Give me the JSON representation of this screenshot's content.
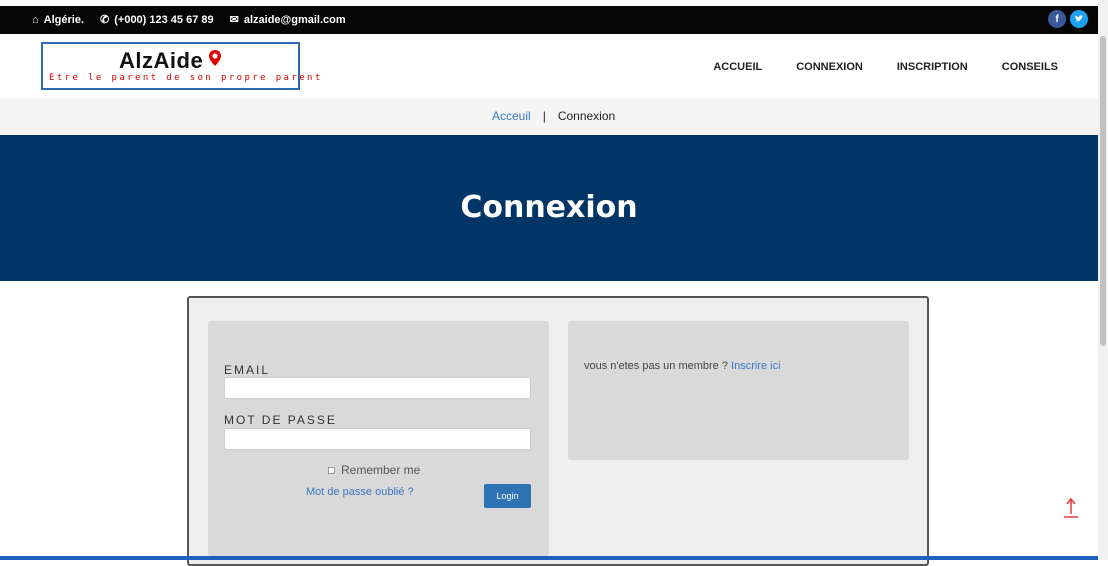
{
  "topbar": {
    "location": "Algérie.",
    "phone": "(+000) 123 45 67 89",
    "email": "alzaide@gmail.com",
    "location_icon": "home-icon",
    "phone_icon": "phone-icon",
    "email_icon": "envelope-icon",
    "social": [
      "facebook-icon",
      "twitter-icon"
    ]
  },
  "logo": {
    "name": "AlzAide",
    "tagline": "Etre le parent de son propre parent"
  },
  "nav": {
    "items": [
      "ACCUEIL",
      "CONNEXION",
      "INSCRIPTION",
      "CONSEILS"
    ]
  },
  "breadcrumb": {
    "home": "Acceuil",
    "separator": "|",
    "current": "Connexion"
  },
  "hero": {
    "title": "Connexion"
  },
  "login": {
    "email_label": "EMAIL",
    "email_value": "",
    "password_label": "MOT DE PASSE",
    "password_value": "",
    "remember_label": "Remember me",
    "forgot_label": "Mot de passe oublié ?",
    "submit_label": "Login"
  },
  "signup": {
    "text": "vous n'etes pas un membre ?",
    "link": "Inscrire ici"
  },
  "colors": {
    "hero_bg": "#003566",
    "link": "#3a78c2",
    "button": "#2e74b5",
    "tagline": "#d40000",
    "totop": "#e53935"
  }
}
